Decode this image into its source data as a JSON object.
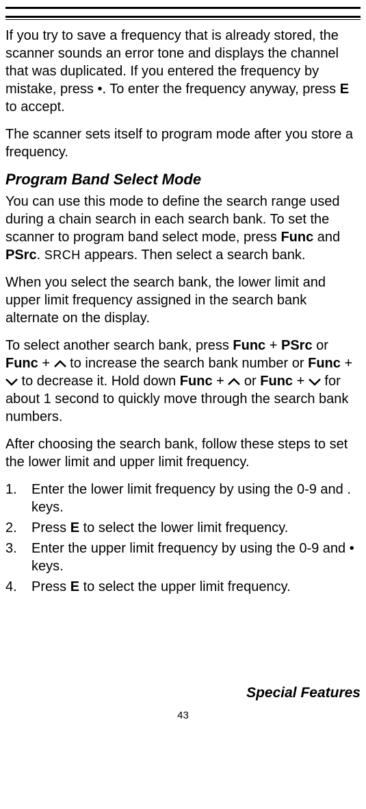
{
  "para1": {
    "t1": "If you try to save a frequency that is already stored, the scanner sounds an error tone and displays the channel that was duplicated. If you entered the frequency by mistake, press ",
    "dot": "•",
    "t2": ". To enter the frequency anyway, press ",
    "e": "E",
    "t3": " to accept."
  },
  "para2": "The scanner sets itself to program mode after you store a frequency.",
  "heading": "Program Band Select Mode",
  "para3": {
    "t1": "You can use this mode to define the search range used during a chain search in each search bank. To set the scanner to program band select mode, press ",
    "func": "Func",
    "and": " and ",
    "psrc": "PSrc",
    "t2": ". ",
    "srch": "SRCH",
    "t3": " appears. Then select a search bank."
  },
  "para4": "When you select the search bank, the lower limit and upper limit frequency assigned in the search bank alternate on the display.",
  "para5": {
    "t1": "To select another search bank, press ",
    "func1": "Func",
    "plus1": " + ",
    "psrc": "PSrc",
    "or1": " or ",
    "func2": "Func",
    "plus2": " + ",
    "t2": "  to increase the search bank number or ",
    "func3": "Func",
    "plus3": " + ",
    "t3": " to decrease it. Hold down ",
    "func4": "Func",
    "plus4": " + ",
    "or2": " or ",
    "func5": "Func",
    "plus5": " + ",
    "t4": " for about 1 second to quickly move through the search bank numbers."
  },
  "para6": "After choosing the search bank, follow these steps to set the lower limit and upper limit frequency.",
  "steps": {
    "s1": "Enter the lower limit frequency by using the 0-9 and . keys.",
    "s2a": "Press ",
    "s2b": "E",
    "s2c": " to select the lower limit frequency.",
    "s3a": "Enter the upper limit frequency by using the 0-9 and ",
    "s3dot": "•",
    "s3b": " keys.",
    "s4a": "Press ",
    "s4b": "E",
    "s4c": " to select the upper limit frequency."
  },
  "footer": "Special Features",
  "page": "43"
}
